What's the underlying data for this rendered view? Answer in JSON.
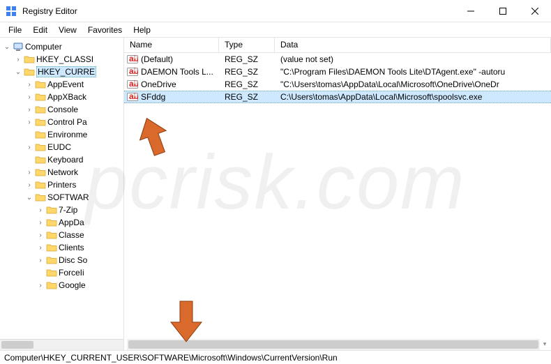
{
  "window": {
    "title": "Registry Editor"
  },
  "menu": {
    "items": [
      "File",
      "Edit",
      "View",
      "Favorites",
      "Help"
    ]
  },
  "tree": [
    {
      "label": "Computer",
      "indent": 0,
      "twisty": "open",
      "icon": "computer"
    },
    {
      "label": "HKEY_CLASSI",
      "indent": 1,
      "twisty": "closed",
      "icon": "folder"
    },
    {
      "label": "HKEY_CURRE",
      "indent": 1,
      "twisty": "open",
      "icon": "folder",
      "selected": true
    },
    {
      "label": "AppEvent",
      "indent": 2,
      "twisty": "closed",
      "icon": "folder"
    },
    {
      "label": "AppXBack",
      "indent": 2,
      "twisty": "closed",
      "icon": "folder"
    },
    {
      "label": "Console",
      "indent": 2,
      "twisty": "closed",
      "icon": "folder"
    },
    {
      "label": "Control Pa",
      "indent": 2,
      "twisty": "closed",
      "icon": "folder"
    },
    {
      "label": "Environme",
      "indent": 2,
      "twisty": "none",
      "icon": "folder"
    },
    {
      "label": "EUDC",
      "indent": 2,
      "twisty": "closed",
      "icon": "folder"
    },
    {
      "label": "Keyboard",
      "indent": 2,
      "twisty": "none",
      "icon": "folder"
    },
    {
      "label": "Network",
      "indent": 2,
      "twisty": "closed",
      "icon": "folder"
    },
    {
      "label": "Printers",
      "indent": 2,
      "twisty": "closed",
      "icon": "folder"
    },
    {
      "label": "SOFTWAR",
      "indent": 2,
      "twisty": "open",
      "icon": "folder"
    },
    {
      "label": "7-Zip",
      "indent": 3,
      "twisty": "closed",
      "icon": "folder"
    },
    {
      "label": "AppDa",
      "indent": 3,
      "twisty": "closed",
      "icon": "folder"
    },
    {
      "label": "Classe",
      "indent": 3,
      "twisty": "closed",
      "icon": "folder"
    },
    {
      "label": "Clients",
      "indent": 3,
      "twisty": "closed",
      "icon": "folder"
    },
    {
      "label": "Disc So",
      "indent": 3,
      "twisty": "closed",
      "icon": "folder"
    },
    {
      "label": "ForceIi",
      "indent": 3,
      "twisty": "none",
      "icon": "folder"
    },
    {
      "label": "Google",
      "indent": 3,
      "twisty": "closed",
      "icon": "folder"
    }
  ],
  "list": {
    "headers": {
      "name": "Name",
      "type": "Type",
      "data": "Data"
    },
    "rows": [
      {
        "name": "(Default)",
        "type": "REG_SZ",
        "data": "(value not set)",
        "selected": false
      },
      {
        "name": "DAEMON Tools L...",
        "type": "REG_SZ",
        "data": "\"C:\\Program Files\\DAEMON Tools Lite\\DTAgent.exe\" -autoru",
        "selected": false
      },
      {
        "name": "OneDrive",
        "type": "REG_SZ",
        "data": "\"C:\\Users\\tomas\\AppData\\Local\\Microsoft\\OneDrive\\OneDr",
        "selected": false
      },
      {
        "name": "SFddg",
        "type": "REG_SZ",
        "data": "C:\\Users\\tomas\\AppData\\Local\\Microsoft\\spoolsvc.exe",
        "selected": true
      }
    ]
  },
  "status": {
    "path": "Computer\\HKEY_CURRENT_USER\\SOFTWARE\\Microsoft\\Windows\\CurrentVersion\\Run"
  },
  "watermark": "pcrisk.com"
}
